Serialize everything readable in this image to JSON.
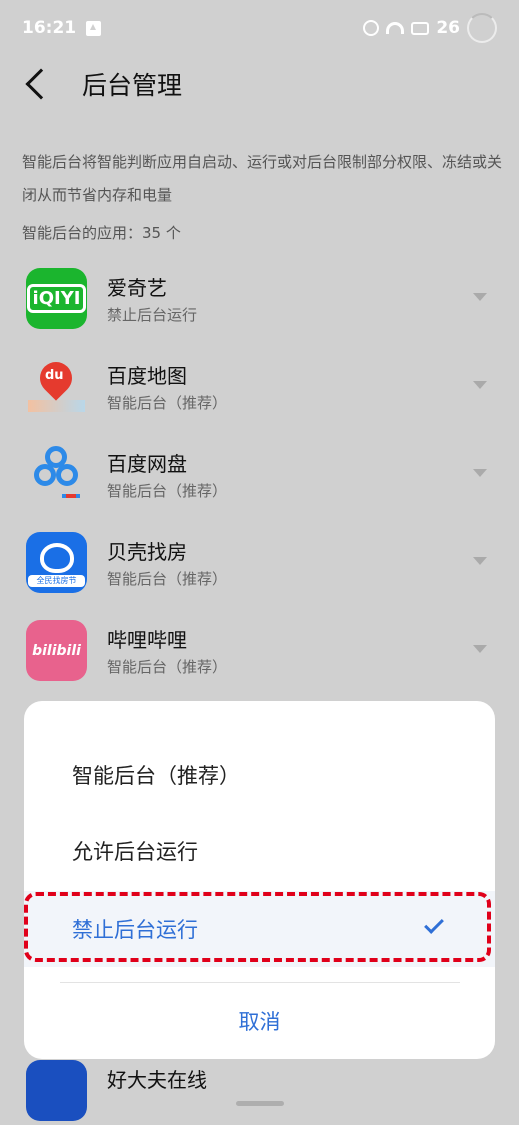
{
  "status_bar": {
    "time": "16:21",
    "battery_level": "26"
  },
  "header": {
    "title": "后台管理"
  },
  "description": "智能后台将智能判断应用自启动、运行或对后台限制部分权限、冻结或关闭从而节省内存和电量",
  "app_count_label": "智能后台的应用：35 个",
  "apps": [
    {
      "name": "爱奇艺",
      "status": "禁止后台运行",
      "icon": "iqiyi-icon",
      "icon_text": "iQIYI",
      "icon_color": "#1bb52e"
    },
    {
      "name": "百度地图",
      "status": "智能后台（推荐）",
      "icon": "baidu-map-icon",
      "icon_text": "du"
    },
    {
      "name": "百度网盘",
      "status": "智能后台（推荐）",
      "icon": "baidu-pan-icon"
    },
    {
      "name": "贝壳找房",
      "status": "智能后台（推荐）",
      "icon": "beike-icon",
      "icon_text": "全民找房节",
      "icon_color": "#1a6fe6"
    },
    {
      "name": "哔哩哔哩",
      "status": "智能后台（推荐）",
      "icon": "bilibili-icon",
      "icon_text": "bilibili",
      "icon_color": "#e8628d"
    },
    {
      "name": "好大夫在线",
      "icon": "haodf-icon"
    }
  ],
  "sheet": {
    "options": [
      {
        "label": "智能后台（推荐）",
        "selected": false
      },
      {
        "label": "允许后台运行",
        "selected": false
      },
      {
        "label": "禁止后台运行",
        "selected": true
      }
    ],
    "cancel_label": "取消"
  },
  "colors": {
    "accent": "#2f6fd6",
    "highlight": "#e0001a",
    "overlay": "#d0d0d0"
  }
}
